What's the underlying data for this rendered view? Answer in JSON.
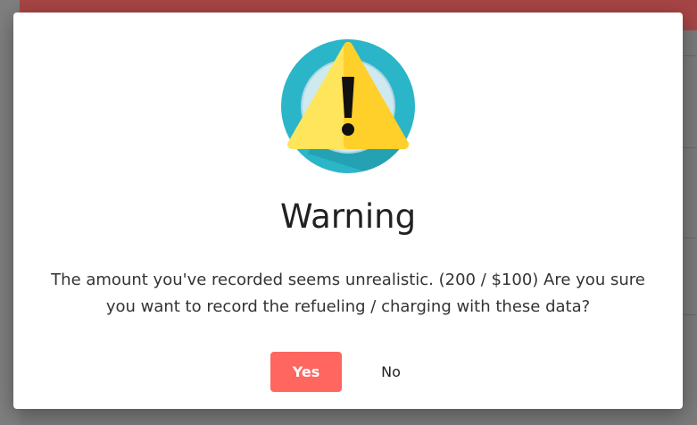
{
  "dialog": {
    "icon": "warning-icon",
    "title": "Warning",
    "message": "The amount you've recorded seems unrealistic. (200 / $100) Are you sure you want to record the refueling / charging with these data?",
    "yes_label": "Yes",
    "no_label": "No"
  },
  "colors": {
    "accent": "#ff6660",
    "header": "#a74545",
    "icon_circle": "#2bb5c8",
    "warning_yellow": "#ffd83a"
  }
}
